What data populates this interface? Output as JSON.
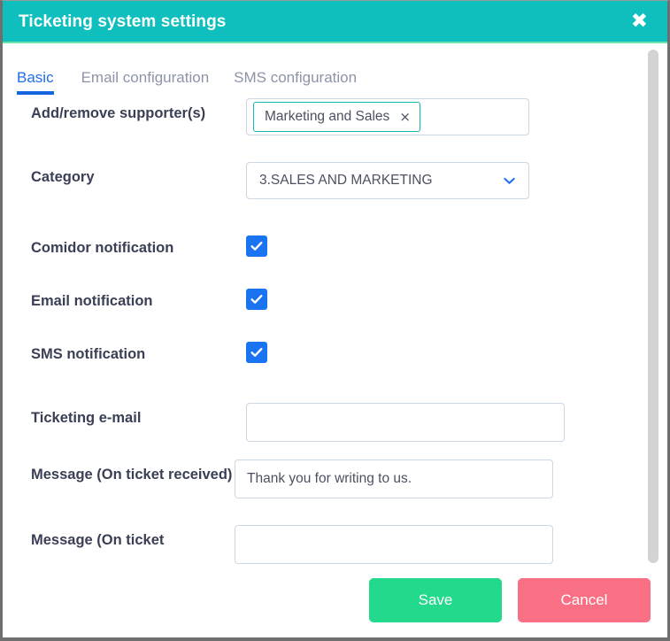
{
  "dialog": {
    "title": "Ticketing system settings",
    "close_icon": "close-icon",
    "header_color": "#0ebfbd"
  },
  "tabs": [
    {
      "label": "Basic",
      "active": true
    },
    {
      "label": "Email configuration",
      "active": false
    },
    {
      "label": "SMS configuration",
      "active": false
    }
  ],
  "form": {
    "supporters": {
      "label": "Add/remove supporter(s)",
      "tokens": [
        {
          "text": "Marketing and Sales",
          "remove_icon": "×"
        }
      ],
      "placeholder": ""
    },
    "category": {
      "label": "Category",
      "value": "3.SALES AND MARKETING",
      "chevron_icon": "chevron-down-icon",
      "chevron_color": "#1e6ef0"
    },
    "comidor_notification": {
      "label": "Comidor notification",
      "checked": true
    },
    "email_notification": {
      "label": "Email notification",
      "checked": true
    },
    "sms_notification": {
      "label": "SMS notification",
      "checked": true
    },
    "ticketing_email": {
      "label": "Ticketing e-mail",
      "value": "",
      "placeholder": ""
    },
    "message_received": {
      "label": "Message (On ticket received)",
      "value": "Thank you for writing to us.",
      "placeholder": ""
    },
    "message_partial": {
      "label": "Message (On ticket",
      "value": "",
      "placeholder": ""
    }
  },
  "footer": {
    "save_label": "Save",
    "cancel_label": "Cancel",
    "save_color": "#22d98c",
    "cancel_color": "#f97084"
  }
}
